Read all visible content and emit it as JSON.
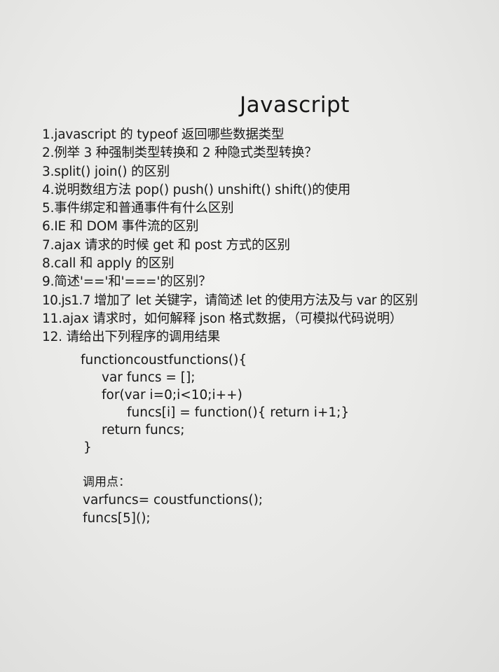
{
  "title": "Javascript",
  "questions": [
    "1.javascript 的 typeof 返回哪些数据类型",
    "2.例举 3 种强制类型转换和 2 种隐式类型转换？",
    "3.split() join()  的区别",
    "4.说明数组方法 pop() push() unshift() shift()的使用",
    "5.事件绑定和普通事件有什么区别",
    "6.IE 和 DOM 事件流的区别",
    "7.ajax 请求的时候 get  和 post 方式的区别",
    "8.call 和 apply 的区别",
    "9.简述'=='和'==='的区别？",
    "10.js1.7 增加了 let 关键字，请简述 let 的使用方法及与 var 的区别",
    "11.ajax 请求时，如何解释 json 格式数据，（可模拟代码说明）",
    "12.  请给出下列程序的调用结果"
  ],
  "code": {
    "line1": "functioncoustfunctions(){",
    "line2": "var funcs = [];",
    "line3": "for(var i=0;i<10;i++)",
    "line4": "funcs[i] = function(){ return i+1;}",
    "line5": "return funcs;",
    "line6": "}"
  },
  "call": {
    "label": "调用点：",
    "line1": "varfuncs=  coustfunctions();",
    "line2": "funcs[5]();"
  }
}
